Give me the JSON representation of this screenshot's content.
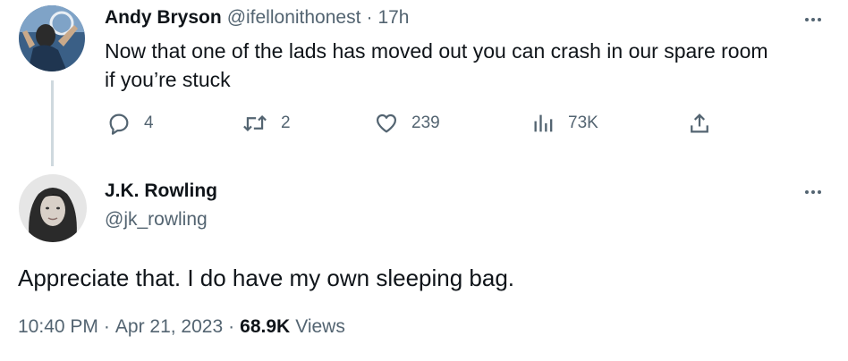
{
  "reply_tweet": {
    "author_name": "Andy Bryson",
    "author_handle": "@ifellonithonest",
    "separator": "·",
    "time": "17h",
    "text_line1": "Now that one of the lads has moved out you can crash in our spare room",
    "text_line2": "if you’re stuck",
    "replies": "4",
    "retweets": "2",
    "likes": "239",
    "views": "73K",
    "avatar_icon": "profile-photo-andy"
  },
  "main_tweet": {
    "author_name": "J.K. Rowling",
    "author_handle": "@jk_rowling",
    "text": "Appreciate that. I do have my own sleeping bag.",
    "time": "10:40 PM",
    "sep1": "·",
    "date": "Apr 21, 2023",
    "sep2": "·",
    "view_count": "68.9K",
    "views_label": "Views",
    "avatar_icon": "profile-photo-jk"
  },
  "colors": {
    "text_primary": "#0f1419",
    "text_secondary": "#536471",
    "thread_line": "#cfd9de"
  }
}
